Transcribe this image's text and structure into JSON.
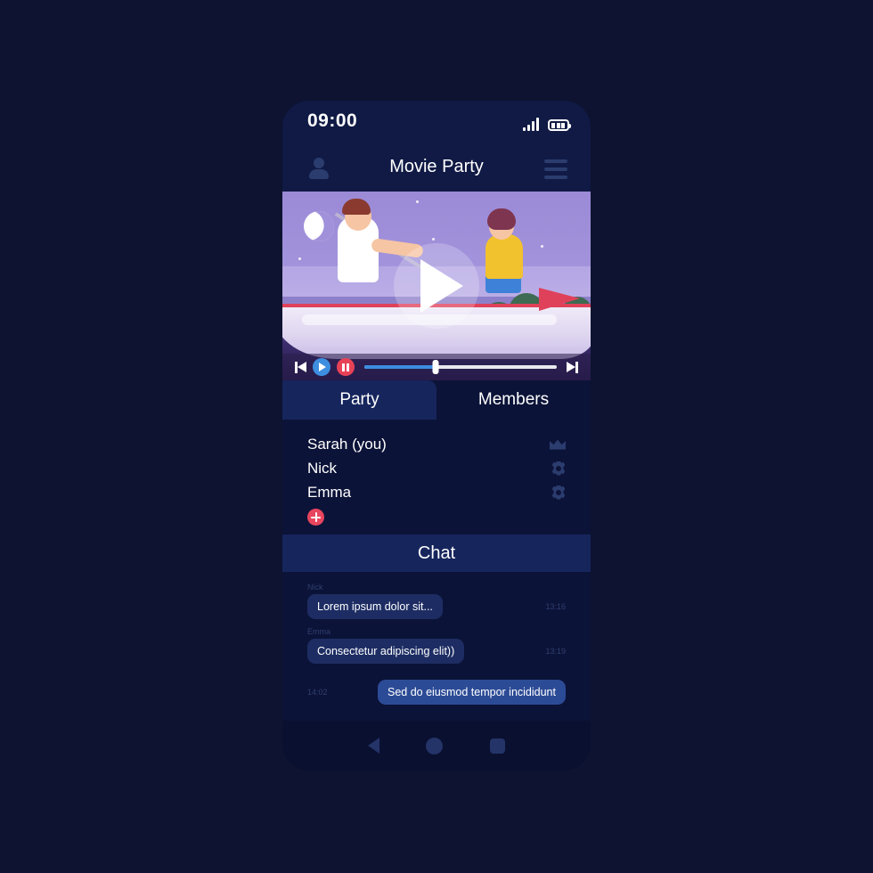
{
  "status_bar": {
    "time": "09:00",
    "signal_icon": "signal-bars-icon",
    "battery_icon": "battery-icon"
  },
  "header": {
    "title": "Movie Party",
    "profile_icon": "person-icon",
    "menu_icon": "hamburger-menu-icon"
  },
  "video": {
    "play_icon": "play-overlay-icon",
    "scene": "night-boat-illustration"
  },
  "player": {
    "prev_icon": "skip-previous-icon",
    "play_icon": "play-icon",
    "pause_icon": "pause-icon",
    "next_icon": "skip-next-icon",
    "progress_percent": 37
  },
  "tabs": [
    {
      "label": "Party",
      "active": true
    },
    {
      "label": "Members",
      "active": false
    }
  ],
  "members": [
    {
      "name": "Sarah (you)",
      "icon": "crown-icon"
    },
    {
      "name": "Nick",
      "icon": "gear-icon"
    },
    {
      "name": "Emma",
      "icon": "gear-icon"
    }
  ],
  "add_member": {
    "icon": "plus-circle-icon"
  },
  "chat": {
    "header": "Chat",
    "messages": [
      {
        "sender": "Nick",
        "text": "Lorem ipsum dolor sit...",
        "time": "13:16",
        "outgoing": false
      },
      {
        "sender": "Emma",
        "text": "Consectetur adipiscing elit))",
        "time": "13:19",
        "outgoing": false
      },
      {
        "sender": "",
        "text": "Sed do eiusmod tempor incididunt",
        "time": "14:02",
        "outgoing": true
      }
    ]
  },
  "navbar": {
    "back_icon": "back-triangle-icon",
    "home_icon": "home-circle-icon",
    "recents_icon": "recents-square-icon"
  },
  "colors": {
    "page_background": "#0d1330",
    "phone_background": "#0c1338",
    "panel": "#16255c",
    "accent_blue": "#3d8ee0",
    "accent_red": "#e8455e",
    "muted_icon": "#2b3c6e"
  }
}
